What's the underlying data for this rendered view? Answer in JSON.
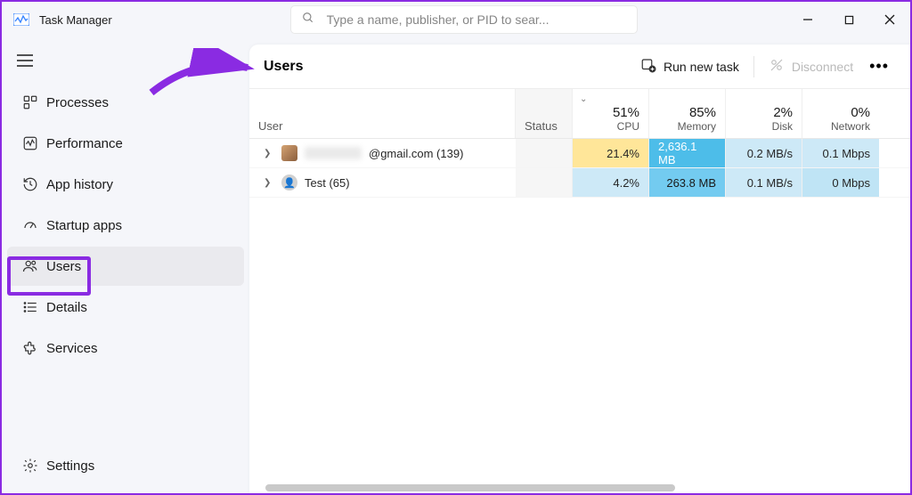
{
  "titlebar": {
    "title": "Task Manager"
  },
  "search": {
    "placeholder": "Type a name, publisher, or PID to sear..."
  },
  "sidebar": {
    "items": [
      {
        "label": "Processes"
      },
      {
        "label": "Performance"
      },
      {
        "label": "App history"
      },
      {
        "label": "Startup apps"
      },
      {
        "label": "Users",
        "active": true
      },
      {
        "label": "Details"
      },
      {
        "label": "Services"
      }
    ],
    "settings_label": "Settings"
  },
  "page": {
    "title": "Users",
    "run_new_task": "Run new task",
    "disconnect": "Disconnect"
  },
  "columns": {
    "user": "User",
    "status": "Status",
    "cpu": {
      "pct": "51%",
      "label": "CPU"
    },
    "memory": {
      "pct": "85%",
      "label": "Memory"
    },
    "disk": {
      "pct": "2%",
      "label": "Disk"
    },
    "network": {
      "pct": "0%",
      "label": "Network"
    }
  },
  "rows": [
    {
      "name_suffix": "@gmail.com (139)",
      "cpu": "21.4%",
      "memory": "2,636.1 MB",
      "disk": "0.2 MB/s",
      "network": "0.1 Mbps"
    },
    {
      "name": "Test (65)",
      "cpu": "4.2%",
      "memory": "263.8 MB",
      "disk": "0.1 MB/s",
      "network": "0 Mbps"
    }
  ]
}
